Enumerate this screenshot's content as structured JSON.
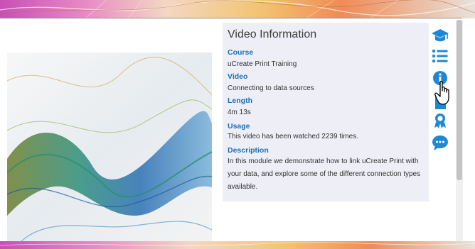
{
  "panel": {
    "title": "Video Information",
    "fields": [
      {
        "label": "Course",
        "value": "uCreate Print Training"
      },
      {
        "label": "Video",
        "value": "Connecting to data sources"
      },
      {
        "label": "Length",
        "value": "4m 13s"
      },
      {
        "label": "Usage",
        "value": "This video has been watched 2239 times."
      },
      {
        "label": "Description",
        "value": "In this module we demonstrate how to link uCreate Print with your data, and explore some of the different connection types available."
      }
    ]
  },
  "rail": {
    "icons": [
      "graduation-cap-icon",
      "list-icon",
      "info-icon",
      "document-icon",
      "award-icon",
      "chat-icon"
    ],
    "accent": "#1e88d6"
  },
  "thumbnail": {
    "icon": "abstract-wave-art"
  }
}
